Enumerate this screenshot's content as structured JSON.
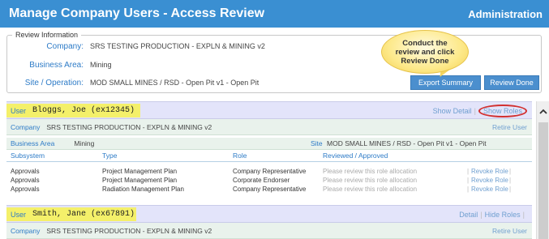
{
  "header": {
    "title": "Manage Company Users - Access Review",
    "admin": "Administration"
  },
  "review_info": {
    "legend": "Review Information",
    "company_label": "Company:",
    "company_value": "SRS TESTING PRODUCTION - EXPLN & MINING v2",
    "business_area_label": "Business Area:",
    "business_area_value": "Mining",
    "site_label": "Site / Operation:",
    "site_value": "MOD SMALL MINES / RSD - Open Pit v1 - Open Pit",
    "export_button": "Export Summary",
    "review_done_button": "Review Done"
  },
  "callout": {
    "line1": "Conduct the",
    "line2": "review and click",
    "line3": "Review Done"
  },
  "users": [
    {
      "label": "User",
      "name": "Bloggs, Joe (ex12345)",
      "detail_link": "Show Detail",
      "roles_link": "Show Roles",
      "company_label": "Company",
      "company_value": "SRS TESTING PRODUCTION - EXPLN & MINING v2",
      "retire_link": "Retire User",
      "business_area_label": "Business Area",
      "business_area_value": "Mining",
      "site_label": "Site",
      "site_value": "MOD SMALL MINES / RSD - Open Pit v1 - Open Pit",
      "columns": [
        "Subsystem",
        "Type",
        "Role",
        "Reviewed / Approved"
      ],
      "rows": [
        {
          "subsystem": "Approvals",
          "type": "Project Management Plan",
          "role": "Company Representative",
          "status": "Please review this role allocation",
          "action": "Revoke Role"
        },
        {
          "subsystem": "Approvals",
          "type": "Project Management Plan",
          "role": "Corporate Endorser",
          "status": "Please review this role allocation",
          "action": "Revoke Role"
        },
        {
          "subsystem": "Approvals",
          "type": "Radiation Management Plan",
          "role": "Company Representative",
          "status": "Please review this role allocation",
          "action": "Revoke Role"
        }
      ]
    },
    {
      "label": "User",
      "name": "Smith, Jane (ex67891)",
      "detail_link": "Detail",
      "roles_link": "Hide Roles",
      "company_label": "Company",
      "company_value": "SRS TESTING PRODUCTION - EXPLN & MINING v2",
      "retire_link": "Retire User"
    }
  ]
}
